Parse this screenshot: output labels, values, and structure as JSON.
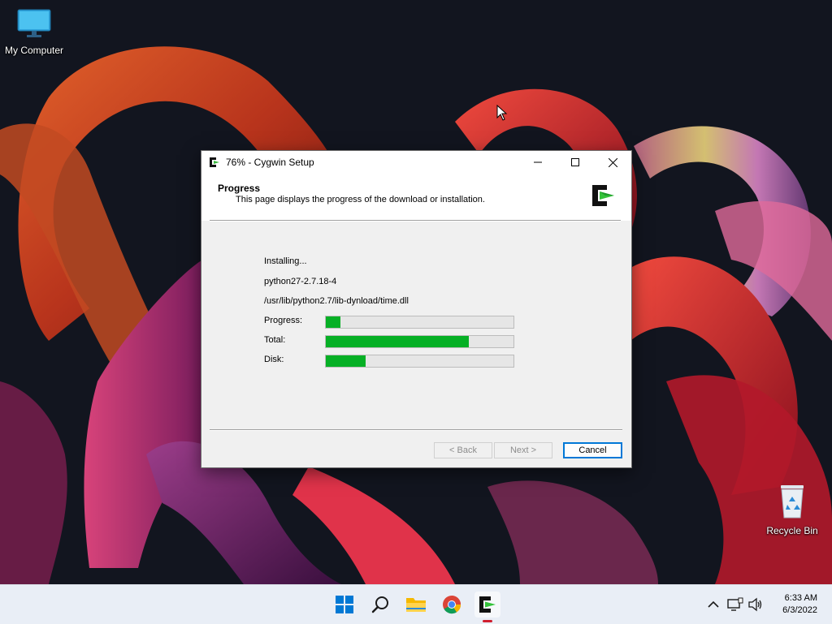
{
  "desktop": {
    "icons": [
      {
        "label": "My Computer"
      },
      {
        "label": "Recycle Bin"
      }
    ]
  },
  "dialog": {
    "title": "76% - Cygwin Setup",
    "header": {
      "title": "Progress",
      "description": "This page displays the progress of the download or installation."
    },
    "status": "Installing...",
    "package": "python27-2.7.18-4",
    "file": "/usr/lib/python2.7/lib-dynload/time.dll",
    "progress_rows": [
      {
        "label": "Progress:",
        "fraction": 0.08
      },
      {
        "label": "Total:",
        "fraction": 0.76
      },
      {
        "label": "Disk:",
        "fraction": 0.21
      }
    ],
    "buttons": {
      "back": "< Back",
      "next": "Next >",
      "cancel": "Cancel"
    }
  },
  "taskbar": {
    "apps": [
      "start-icon",
      "search-icon",
      "file-explorer-icon",
      "chrome-icon",
      "cygwin-icon"
    ],
    "clock": {
      "time": "6:33 AM",
      "date": "6/3/2022"
    }
  },
  "colors": {
    "progress_fill": "#06b025",
    "accent": "#0078d7"
  }
}
